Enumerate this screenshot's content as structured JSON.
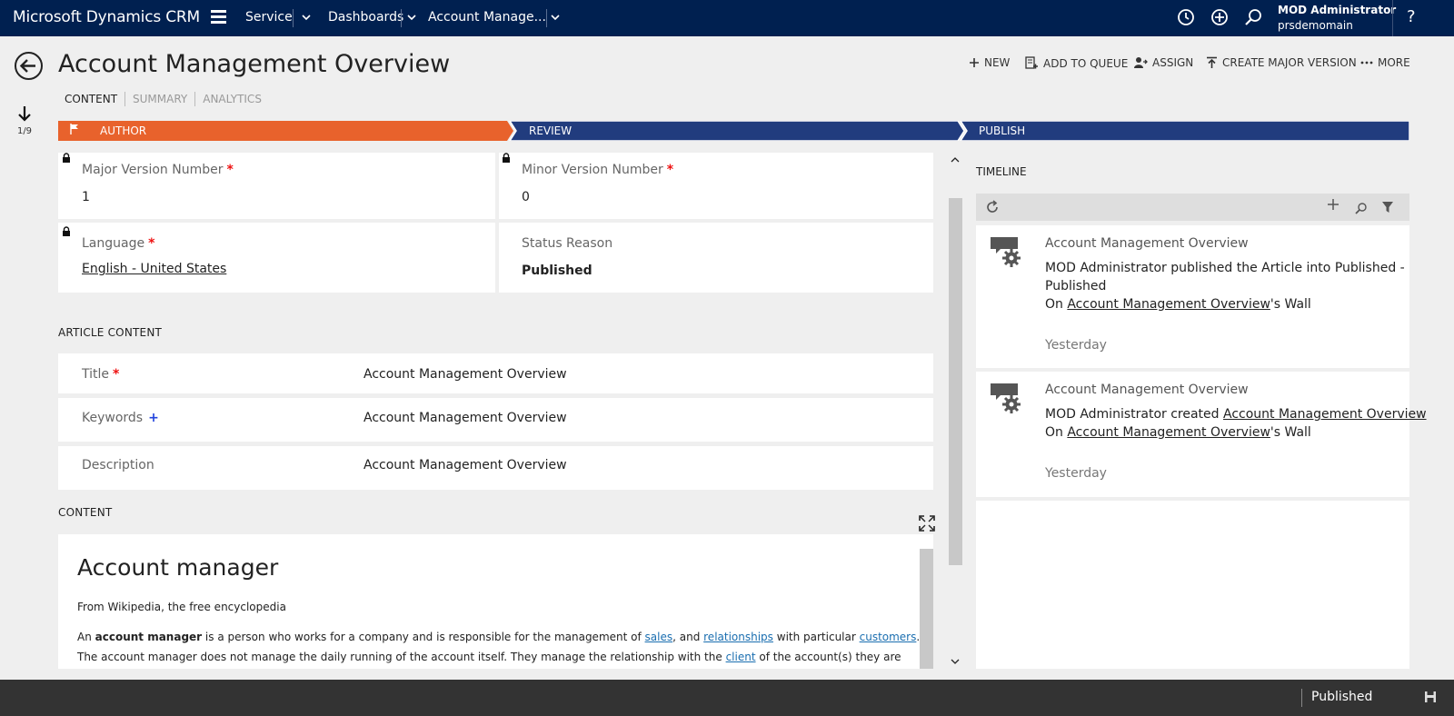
{
  "nav": {
    "brand": "Microsoft Dynamics CRM",
    "crumbs": [
      "Service",
      "Dashboards",
      "Account Manage..."
    ],
    "user_name": "MOD Administrator",
    "org": "prsdemomain",
    "help": "?"
  },
  "header": {
    "title": "Account Management Overview",
    "commands": [
      "NEW",
      "ADD TO QUEUE",
      "ASSIGN",
      "CREATE MAJOR VERSION",
      "MORE"
    ],
    "tabs": [
      "CONTENT",
      "SUMMARY",
      "ANALYTICS"
    ],
    "record_position": "1/9"
  },
  "process": {
    "stages": [
      "AUTHOR",
      "REVIEW",
      "PUBLISH"
    ],
    "colors": {
      "active": "#e8622c",
      "inactive": "#213c7e"
    }
  },
  "fields": {
    "major_version": {
      "label": "Major Version Number",
      "value": "1"
    },
    "minor_version": {
      "label": "Minor Version Number",
      "value": "0"
    },
    "language": {
      "label": "Language",
      "value": "English - United States"
    },
    "status_reason": {
      "label": "Status Reason",
      "value": "Published"
    },
    "required_marker": "*",
    "recommended_marker": "+"
  },
  "article_content": {
    "section_title": "ARTICLE CONTENT",
    "title": {
      "label": "Title",
      "value": "Account Management Overview"
    },
    "keywords": {
      "label": "Keywords",
      "value": "Account Management Overview"
    },
    "description": {
      "label": "Description",
      "value": "Account Management Overview"
    }
  },
  "content": {
    "section_title": "CONTENT",
    "heading": "Account manager",
    "source": "From Wikipedia, the free encyclopedia",
    "para1": {
      "t1": "An ",
      "b1": "account manager",
      "t2": " is a person who works for a company and is responsible for the management of ",
      "l1": "sales",
      "t3": ", and ",
      "l2": "relationships",
      "t4": " with particular ",
      "l3": "customers",
      "t5": "."
    },
    "para2": {
      "t1": "The account manager does not manage the daily running of the account itself. They manage the relationship with the ",
      "l1": "client",
      "t2": " of the account(s) they are"
    }
  },
  "timeline": {
    "title": "TIMELINE",
    "posts": [
      {
        "title": "Account Management Overview",
        "line1": "MOD Administrator published the Article into Published -",
        "line2": "Published",
        "wall_prefix": "On ",
        "wall_link": "Account Management Overview",
        "wall_suffix": "'s Wall",
        "time": "Yesterday"
      },
      {
        "title": "Account Management Overview",
        "line1": "MOD Administrator created ",
        "line1_link": "Account Management Overview",
        "wall_prefix": "On ",
        "wall_link": "Account Management Overview",
        "wall_suffix": "'s Wall",
        "time": "Yesterday"
      }
    ]
  },
  "footer": {
    "status": "Published"
  }
}
